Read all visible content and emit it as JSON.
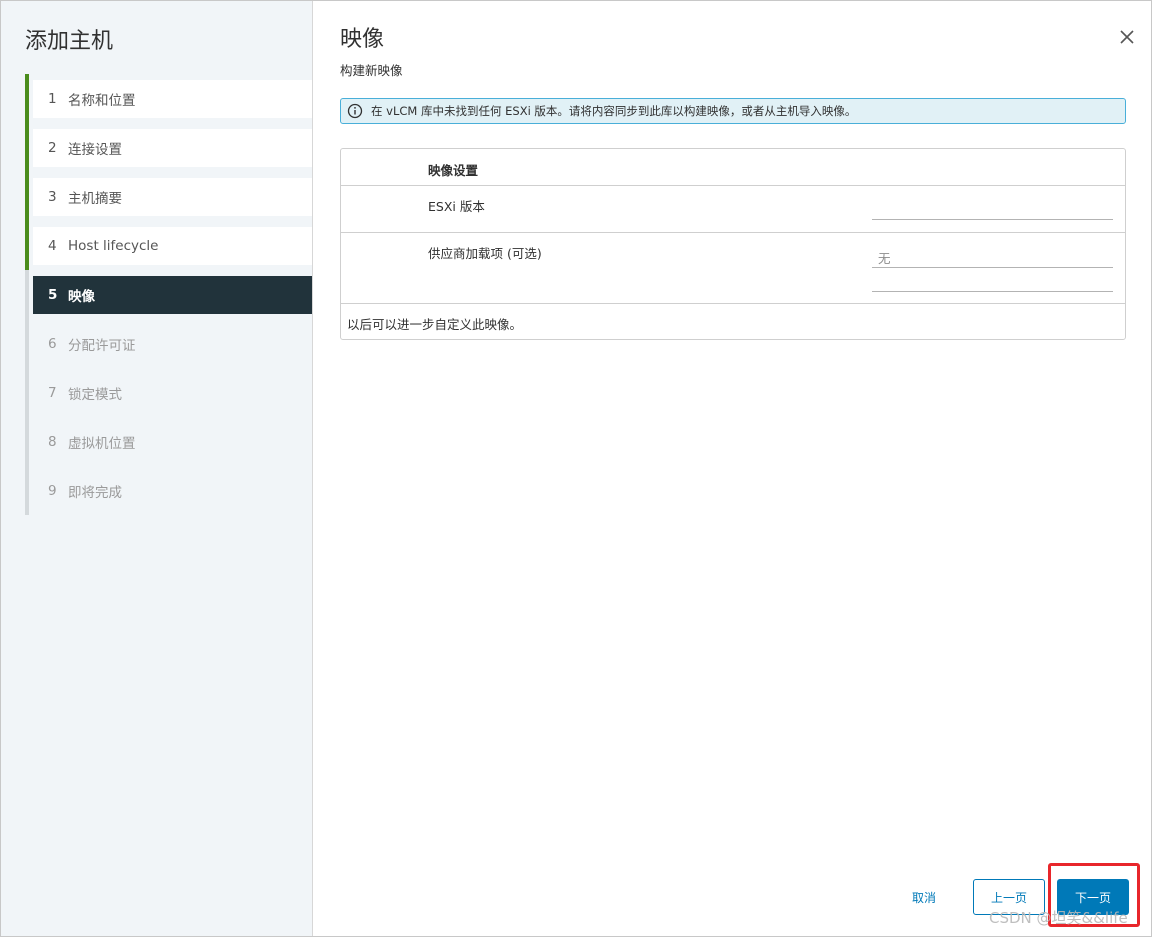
{
  "wizard": {
    "title": "添加主机"
  },
  "steps": [
    {
      "num": "1",
      "label": "名称和位置",
      "state": "done"
    },
    {
      "num": "2",
      "label": "连接设置",
      "state": "done"
    },
    {
      "num": "3",
      "label": "主机摘要",
      "state": "done"
    },
    {
      "num": "4",
      "label": "Host lifecycle",
      "state": "done"
    },
    {
      "num": "5",
      "label": "映像",
      "state": "current"
    },
    {
      "num": "6",
      "label": "分配许可证",
      "state": "pending"
    },
    {
      "num": "7",
      "label": "锁定模式",
      "state": "pending"
    },
    {
      "num": "8",
      "label": "虚拟机位置",
      "state": "pending"
    },
    {
      "num": "9",
      "label": "即将完成",
      "state": "pending"
    }
  ],
  "page": {
    "title": "映像",
    "subtitle": "构建新映像"
  },
  "alert": {
    "text": "在 vLCM 库中未找到任何 ESXi 版本。请将内容同步到此库以构建映像，或者从主机导入映像。"
  },
  "image_settings": {
    "header": "映像设置",
    "esxi_label": "ESXi 版本",
    "esxi_value": "",
    "vendor_label": "供应商加载项 (可选)",
    "vendor_value": "无",
    "note": "以后可以进一步自定义此映像。"
  },
  "buttons": {
    "cancel": "取消",
    "back": "上一页",
    "next": "下一页"
  },
  "watermark": "CSDN @坦笑&&life",
  "colors": {
    "accent": "#0079b8",
    "done": "#4a8c1c",
    "current_bg": "#21333b",
    "highlight": "#e8262b"
  }
}
